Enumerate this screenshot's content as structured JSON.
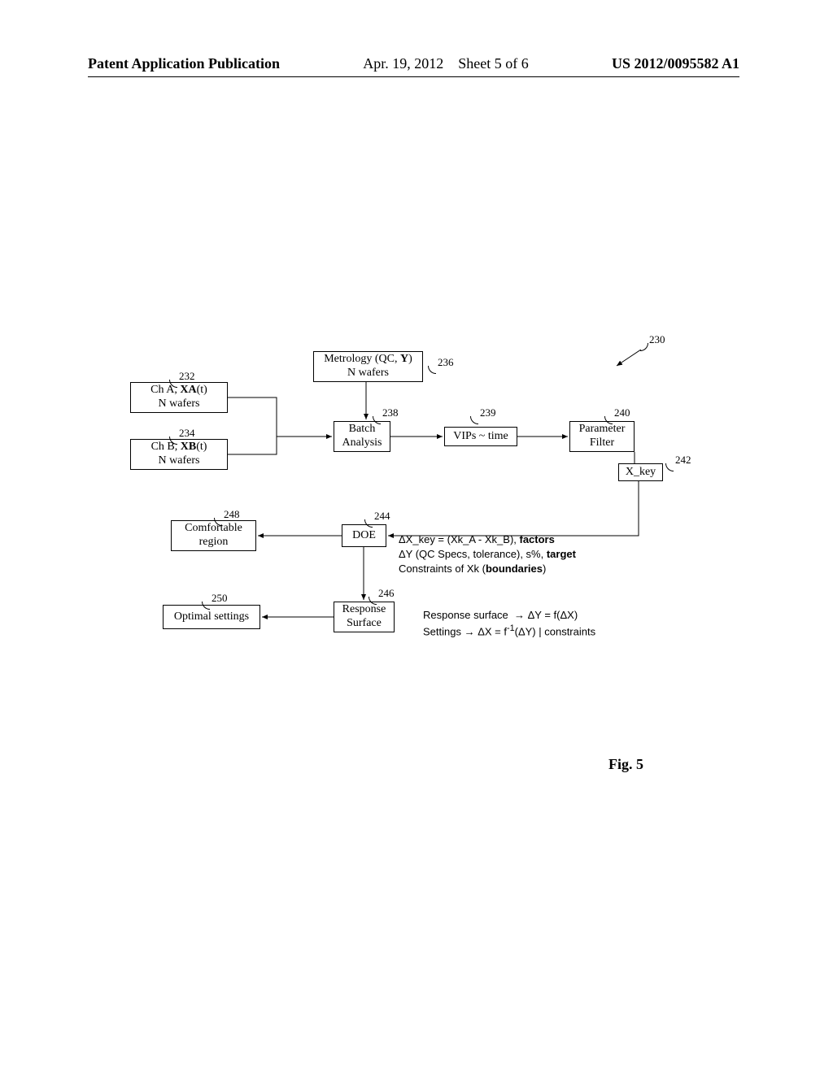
{
  "header": {
    "pub": "Patent Application Publication",
    "date": "Apr. 19, 2012",
    "sheet": "Sheet 5 of 6",
    "docnum": "US 2012/0095582 A1"
  },
  "refs": {
    "r230": "230",
    "r232": "232",
    "r234": "234",
    "r236": "236",
    "r238": "238",
    "r239": "239",
    "r240": "240",
    "r242": "242",
    "r244": "244",
    "r246": "246",
    "r248": "248",
    "r250": "250"
  },
  "boxes": {
    "metrology_l1": "Metrology (QC, Y)",
    "metrology_l2": "N wafers",
    "cha_l1": "Ch A, XA(t)",
    "cha_l2": "N wafers",
    "chb_l1": "Ch B, XB(t)",
    "chb_l2": "N wafers",
    "batch_l1": "Batch",
    "batch_l2": "Analysis",
    "vips": "VIPs ~ time",
    "param_l1": "Parameter",
    "param_l2": "Filter",
    "xkey": "X_key",
    "doe": "DOE",
    "comfort_l1": "Comfortable",
    "comfort_l2": "region",
    "resp_l1": "Response",
    "resp_l2": "Surface",
    "optimal": "Optimal settings"
  },
  "annot": {
    "doe_l1": "ΔX_key = (Xk_A - Xk_B), factors",
    "doe_l2": "ΔY (QC Specs, tolerance), s%, target",
    "doe_l3": "Constraints of Xk (boundaries)",
    "rs_l1": "Response surface  → ΔY = f(ΔX)",
    "rs_l2": "Settings → ΔX = f⁻¹(ΔY) | constraints"
  },
  "figure": "Fig. 5"
}
